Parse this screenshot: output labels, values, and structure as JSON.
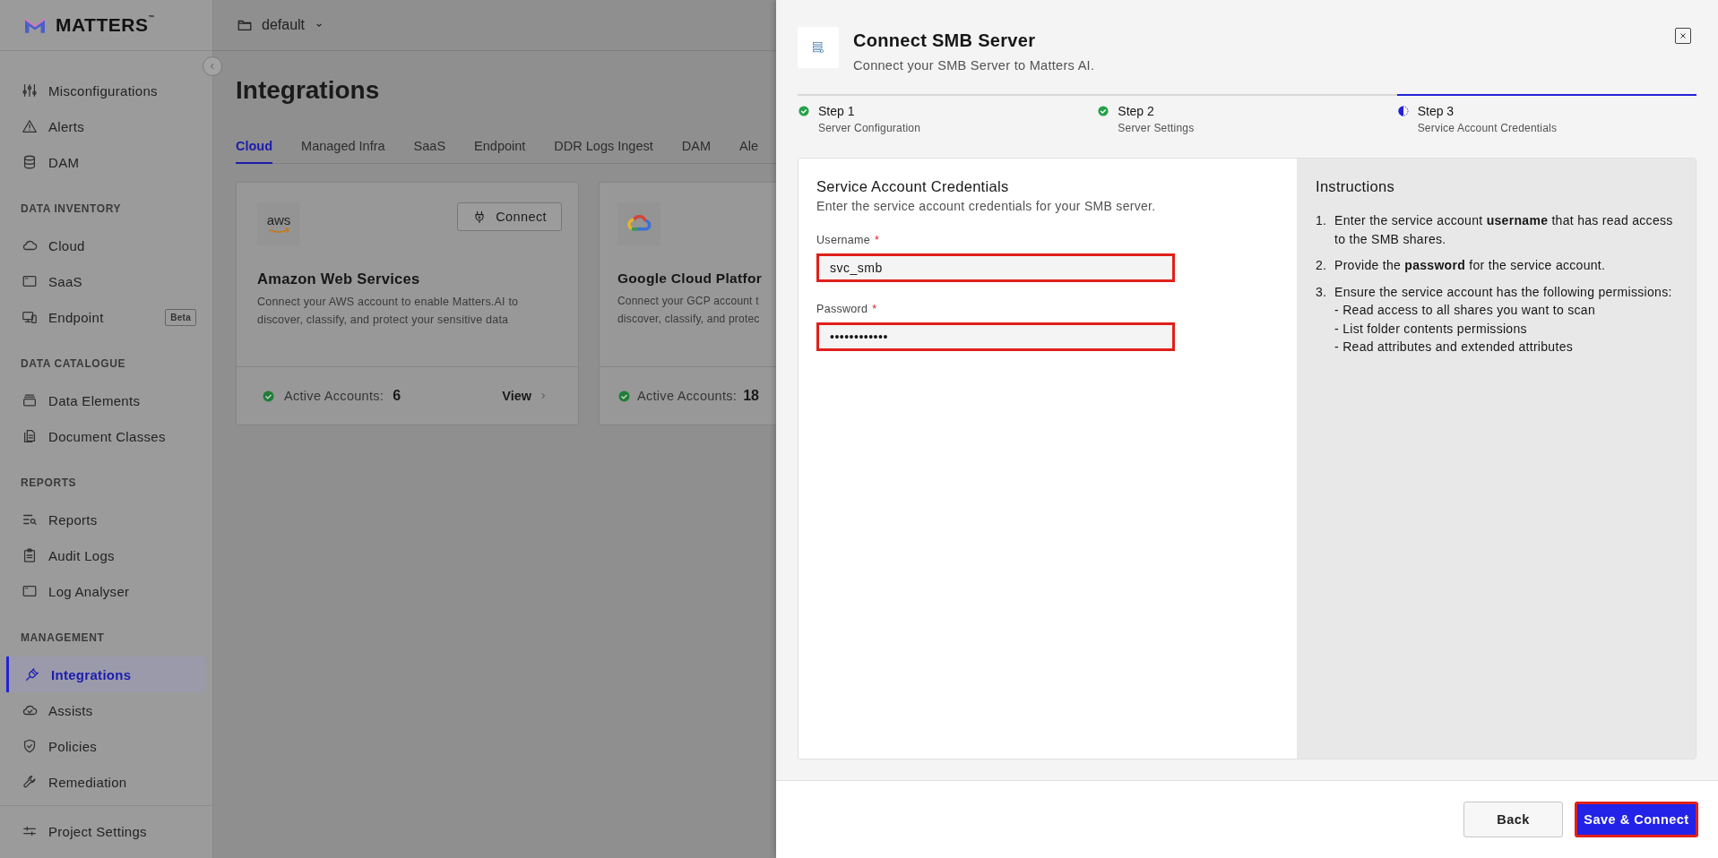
{
  "sidebar": {
    "logo": "MATTERS",
    "logo_mark": "™",
    "top_items": [
      {
        "label": "Misconfigurations",
        "selected": false
      },
      {
        "label": "Alerts",
        "selected": false
      },
      {
        "label": "DAM",
        "selected": false
      }
    ],
    "sections": [
      {
        "title": "DATA INVENTORY",
        "items": [
          {
            "label": "Cloud",
            "selected": false
          },
          {
            "label": "SaaS",
            "selected": false
          },
          {
            "label": "Endpoint",
            "selected": false,
            "badge": "Beta"
          }
        ]
      },
      {
        "title": "DATA CATALOGUE",
        "items": [
          {
            "label": "Data Elements",
            "selected": false
          },
          {
            "label": "Document Classes",
            "selected": false
          }
        ]
      },
      {
        "title": "REPORTS",
        "items": [
          {
            "label": "Reports",
            "selected": false
          },
          {
            "label": "Audit Logs",
            "selected": false
          },
          {
            "label": "Log Analyser",
            "selected": false
          }
        ]
      },
      {
        "title": "MANAGEMENT",
        "items": [
          {
            "label": "Integrations",
            "selected": true
          },
          {
            "label": "Assists",
            "selected": false
          },
          {
            "label": "Policies",
            "selected": false
          },
          {
            "label": "Remediation",
            "selected": false
          }
        ]
      }
    ],
    "footer_items": [
      {
        "label": "Project Settings",
        "selected": false
      }
    ]
  },
  "topbar": {
    "project": "default"
  },
  "page": {
    "title": "Integrations",
    "tabs": [
      {
        "label": "Cloud",
        "selected": true
      },
      {
        "label": "Managed Infra",
        "selected": false
      },
      {
        "label": "SaaS",
        "selected": false
      },
      {
        "label": "Endpoint",
        "selected": false
      },
      {
        "label": "DDR Logs Ingest",
        "selected": false
      },
      {
        "label": "DAM",
        "selected": false
      },
      {
        "label": "Ale",
        "selected": false
      }
    ],
    "cards": [
      {
        "kind": "aws",
        "logo_text": "aws",
        "title": "Amazon Web Services",
        "description_lines": [
          "Connect your AWS account to enable Matters.AI to",
          "discover, classify, and protect your sensitive data"
        ],
        "action": "Connect",
        "status_label": "Active Accounts:",
        "count": "6",
        "link": "View"
      },
      {
        "kind": "gcp",
        "title": "Google Cloud Platfor",
        "description_lines": [
          "Connect your GCP account t",
          "discover, classify, and protec"
        ],
        "status_label": "Active Accounts:",
        "count": "18"
      }
    ]
  },
  "drawer": {
    "title": "Connect SMB Server",
    "subtitle": "Connect your SMB Server to Matters AI.",
    "steps": [
      {
        "title": "Step 1",
        "subtitle": "Server Configuration",
        "complete": true,
        "current": false
      },
      {
        "title": "Step 2",
        "subtitle": "Server Settings",
        "complete": true,
        "current": false
      },
      {
        "title": "Step 3",
        "subtitle": "Service Account Credentials",
        "complete": false,
        "current": true
      }
    ],
    "form": {
      "title": "Service Account Credentials",
      "description": "Enter the service account credentials for your SMB server.",
      "fields": [
        {
          "label": "Username",
          "required_mark": "*",
          "value": "svc_smb",
          "highlighted": true
        },
        {
          "label": "Password",
          "required_mark": "*",
          "value": "••••••••••••",
          "highlighted": true
        }
      ]
    },
    "instructions": {
      "title": "Instructions",
      "items": [
        {
          "number": "1.",
          "text": "Enter the service account **username** that has read access to the SMB shares."
        },
        {
          "number": "2.",
          "text": "Provide the **password** for the service account."
        },
        {
          "number": "3.",
          "text": "Ensure the service account has the following permissions:",
          "sub_items": [
            "- Read access to all shares you want to scan",
            "- List folder contents permissions",
            "- Read attributes and extended attributes"
          ]
        }
      ]
    },
    "buttons": [
      {
        "label": "Back",
        "kind": "secondary",
        "highlighted": false
      },
      {
        "label": "Save & Connect",
        "kind": "primary",
        "highlighted": true
      }
    ]
  }
}
